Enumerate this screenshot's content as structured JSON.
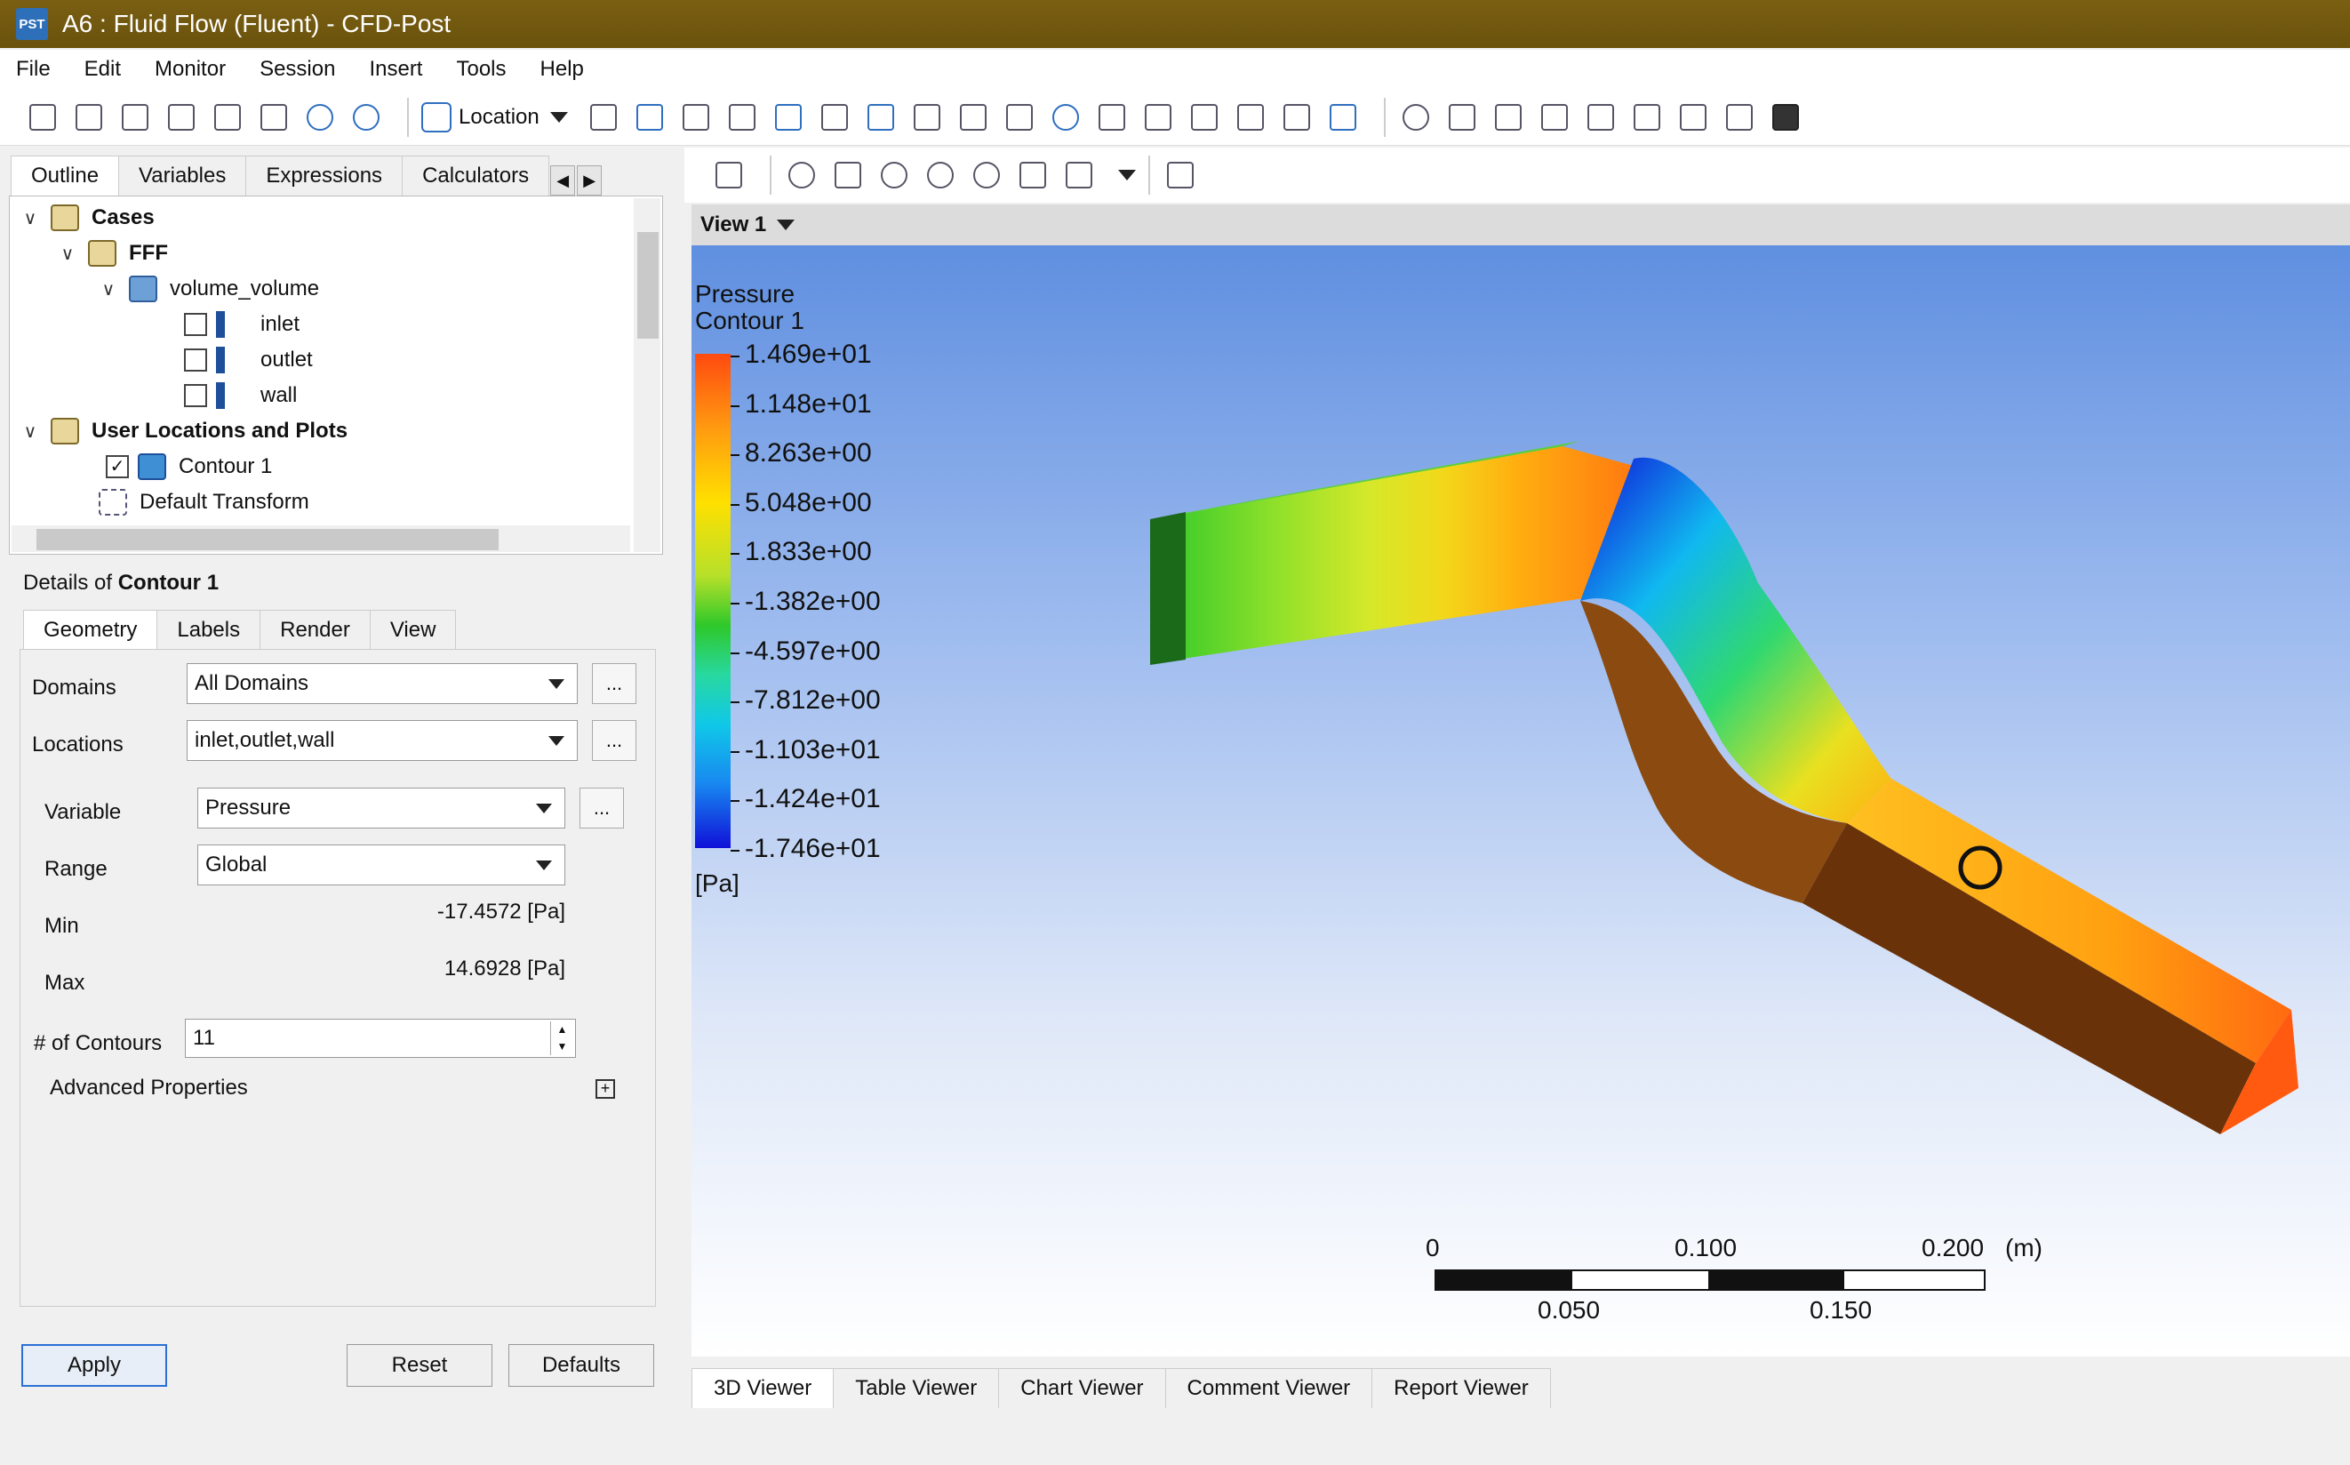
{
  "window": {
    "app_icon": "PST",
    "title": "A6 : Fluid Flow (Fluent) - CFD-Post"
  },
  "menu": [
    "File",
    "Edit",
    "Monitor",
    "Session",
    "Insert",
    "Tools",
    "Help"
  ],
  "toolbar": {
    "location_label": "Location"
  },
  "outline": {
    "tabs": [
      "Outline",
      "Variables",
      "Expressions",
      "Calculators"
    ],
    "active_tab": "Outline",
    "tree": {
      "cases": "Cases",
      "fff": "FFF",
      "volume": "volume_volume",
      "inlet": "inlet",
      "outlet": "outlet",
      "wall": "wall",
      "user_locations": "User Locations and Plots",
      "contour": "Contour 1",
      "default_transform": "Default Transform"
    }
  },
  "details": {
    "title_prefix": "Details of ",
    "title_object": "Contour 1",
    "tabs": [
      "Geometry",
      "Labels",
      "Render",
      "View"
    ],
    "domains_label": "Domains",
    "domains_value": "All Domains",
    "locations_label": "Locations",
    "locations_value": "inlet,outlet,wall",
    "variable_label": "Variable",
    "variable_value": "Pressure",
    "range_label": "Range",
    "range_value": "Global",
    "min_label": "Min",
    "min_value": "-17.4572 [Pa]",
    "max_label": "Max",
    "max_value": "14.6928 [Pa]",
    "contours_label": "# of Contours",
    "contours_value": "11",
    "advanced_label": "Advanced Properties",
    "ellipsis": "...",
    "expander": "+"
  },
  "buttons": {
    "apply": "Apply",
    "reset": "Reset",
    "defaults": "Defaults"
  },
  "viewer": {
    "view_label": "View 1",
    "legend_title_1": "Pressure",
    "legend_title_2": "Contour 1",
    "legend_values": [
      "1.469e+01",
      "1.148e+01",
      "8.263e+00",
      "5.048e+00",
      "1.833e+00",
      "-1.382e+00",
      "-4.597e+00",
      "-7.812e+00",
      "-1.103e+01",
      "-1.424e+01",
      "-1.746e+01"
    ],
    "legend_unit": "[Pa]",
    "scale_top": [
      "0",
      "0.100",
      "0.200"
    ],
    "scale_unit": "(m)",
    "scale_bottom": [
      "0.050",
      "0.150"
    ],
    "tabs": [
      "3D Viewer",
      "Table Viewer",
      "Chart Viewer",
      "Comment Viewer",
      "Report Viewer"
    ],
    "active_tab": "3D Viewer"
  },
  "colors": {
    "title_bar": "#6e560e",
    "accent": "#2b6fd6",
    "pressure_high": "#ff4a10",
    "pressure_low": "#1010d8"
  }
}
